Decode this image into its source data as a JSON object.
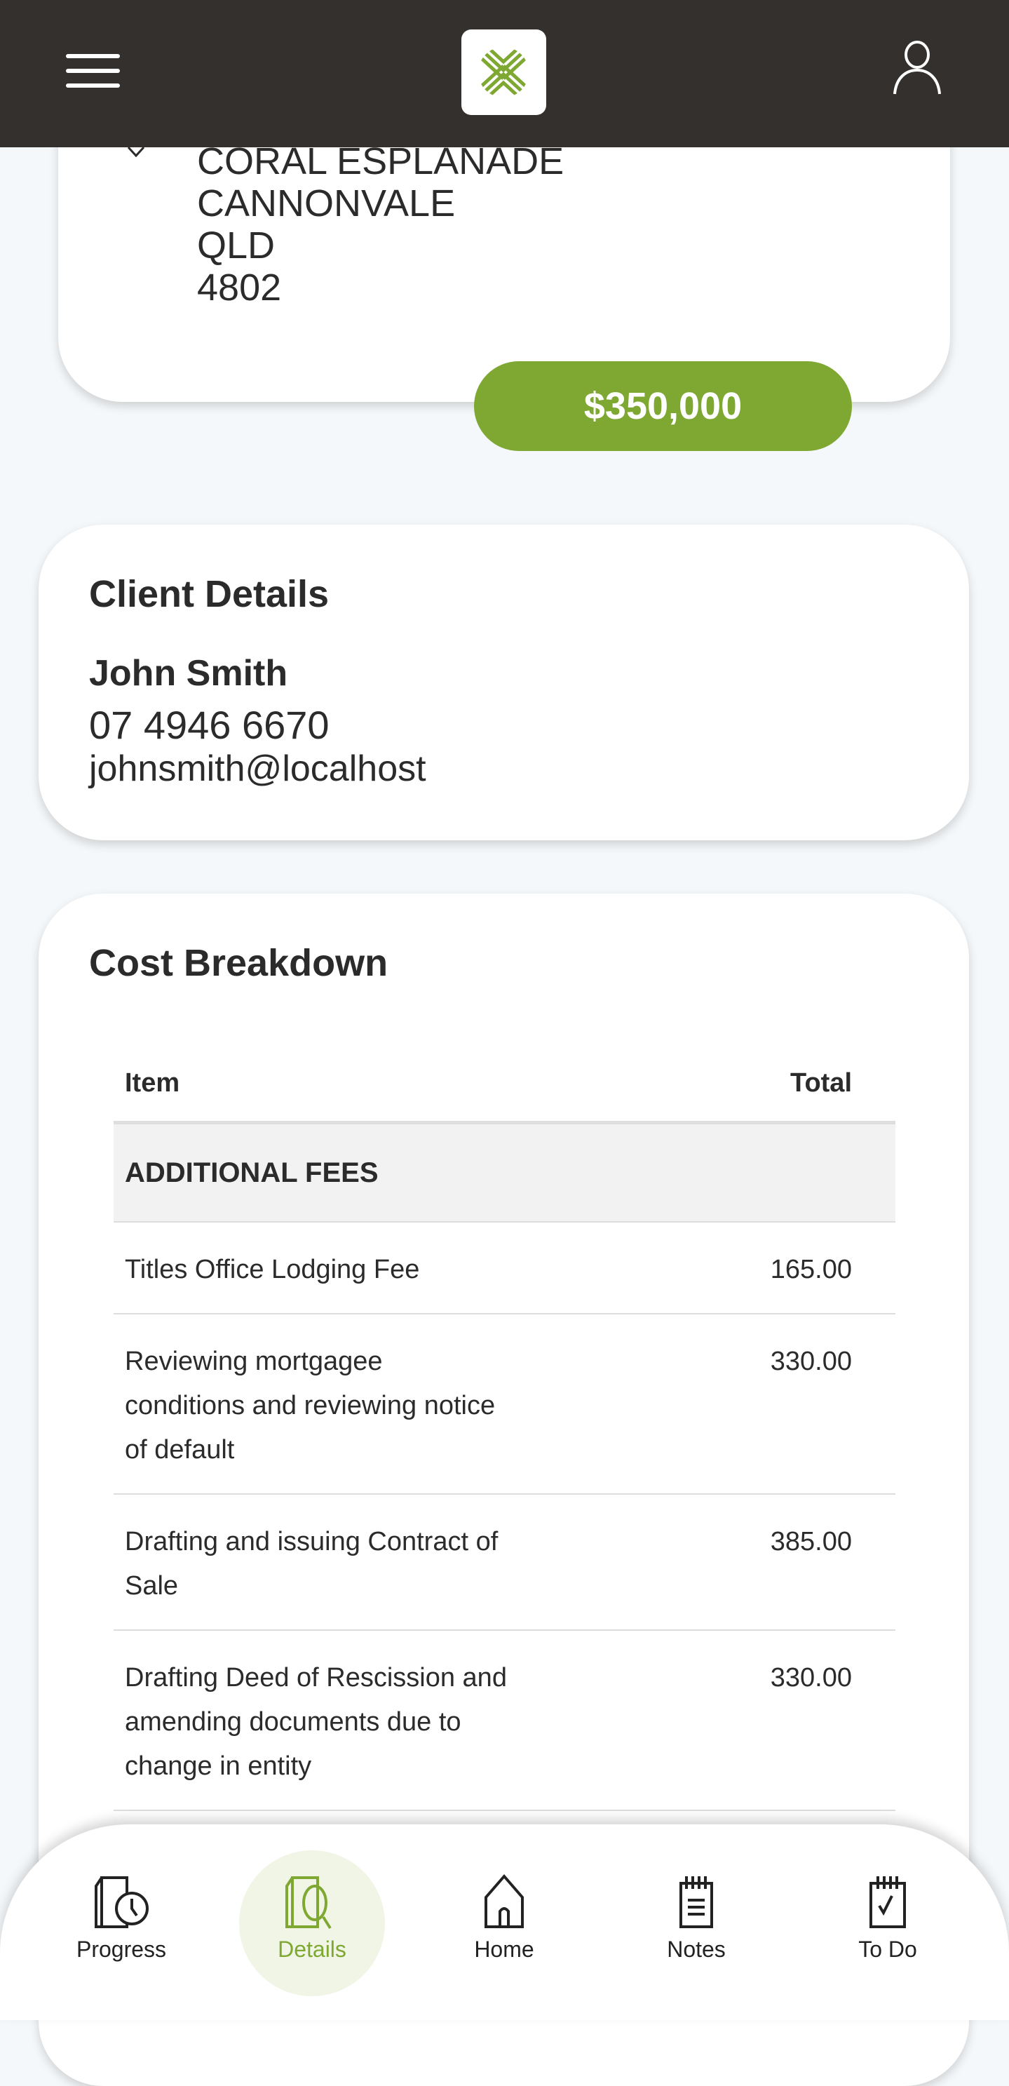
{
  "header": {
    "menu_icon": "hamburger-icon",
    "logo_icon": "leaf-logo",
    "user_icon": "user-icon"
  },
  "property": {
    "address_lines": [
      "CORAL ESPLANADE",
      "CANNONVALE",
      "QLD",
      "4802"
    ],
    "price": "$350,000"
  },
  "client": {
    "title": "Client Details",
    "name": "John Smith",
    "phone": "07 4946 6670",
    "email": "johnsmith@localhost"
  },
  "costs": {
    "title": "Cost Breakdown",
    "columns": {
      "item": "Item",
      "total": "Total"
    },
    "section": "ADDITIONAL FEES",
    "rows": [
      {
        "lines": [
          "Titles Office Lodging Fee"
        ],
        "total": "165.00"
      },
      {
        "lines": [
          "Reviewing mortgagee",
          "conditions and reviewing notice",
          "of default"
        ],
        "total": "330.00"
      },
      {
        "lines": [
          "Drafting and issuing Contract of",
          "Sale"
        ],
        "total": "385.00"
      },
      {
        "lines": [
          "Drafting Deed of Rescission and",
          "amending documents due to",
          "change in entity"
        ],
        "total": "330.00"
      }
    ]
  },
  "nav": {
    "active": "Details",
    "items": [
      {
        "label": "Progress",
        "icon": "document-clock-icon"
      },
      {
        "label": "Details",
        "icon": "document-search-icon"
      },
      {
        "label": "Home",
        "icon": "home-icon"
      },
      {
        "label": "Notes",
        "icon": "notepad-icon"
      },
      {
        "label": "To Do",
        "icon": "checklist-icon"
      }
    ]
  },
  "colors": {
    "header": "#33302d",
    "accent": "#7ea832",
    "background": "#f5f8fa"
  }
}
